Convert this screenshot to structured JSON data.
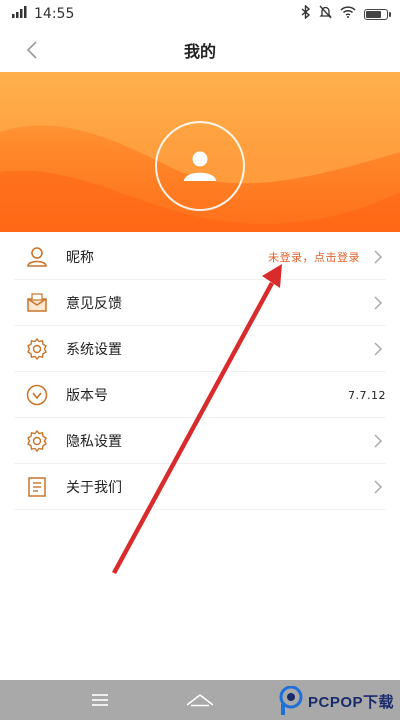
{
  "status_bar": {
    "time": "14:55"
  },
  "header": {
    "title": "我的"
  },
  "menu": {
    "items": [
      {
        "label": "昵称",
        "value": "未登录，点击登录",
        "icon": "user-outline-icon"
      },
      {
        "label": "意见反馈",
        "icon": "feedback-envelope-icon"
      },
      {
        "label": "系统设置",
        "icon": "gear-icon"
      },
      {
        "label": "版本号",
        "value": "7.7.12",
        "icon": "version-circle-icon"
      },
      {
        "label": "隐私设置",
        "icon": "privacy-gear-icon"
      },
      {
        "label": "关于我们",
        "icon": "document-icon"
      }
    ]
  },
  "watermark": {
    "text": "PCPOP下载"
  },
  "colors": {
    "accent": "#ff7a22",
    "login_text": "#e0612a",
    "icon_stroke": "#c8742a",
    "arrow": "#d92b2b"
  }
}
